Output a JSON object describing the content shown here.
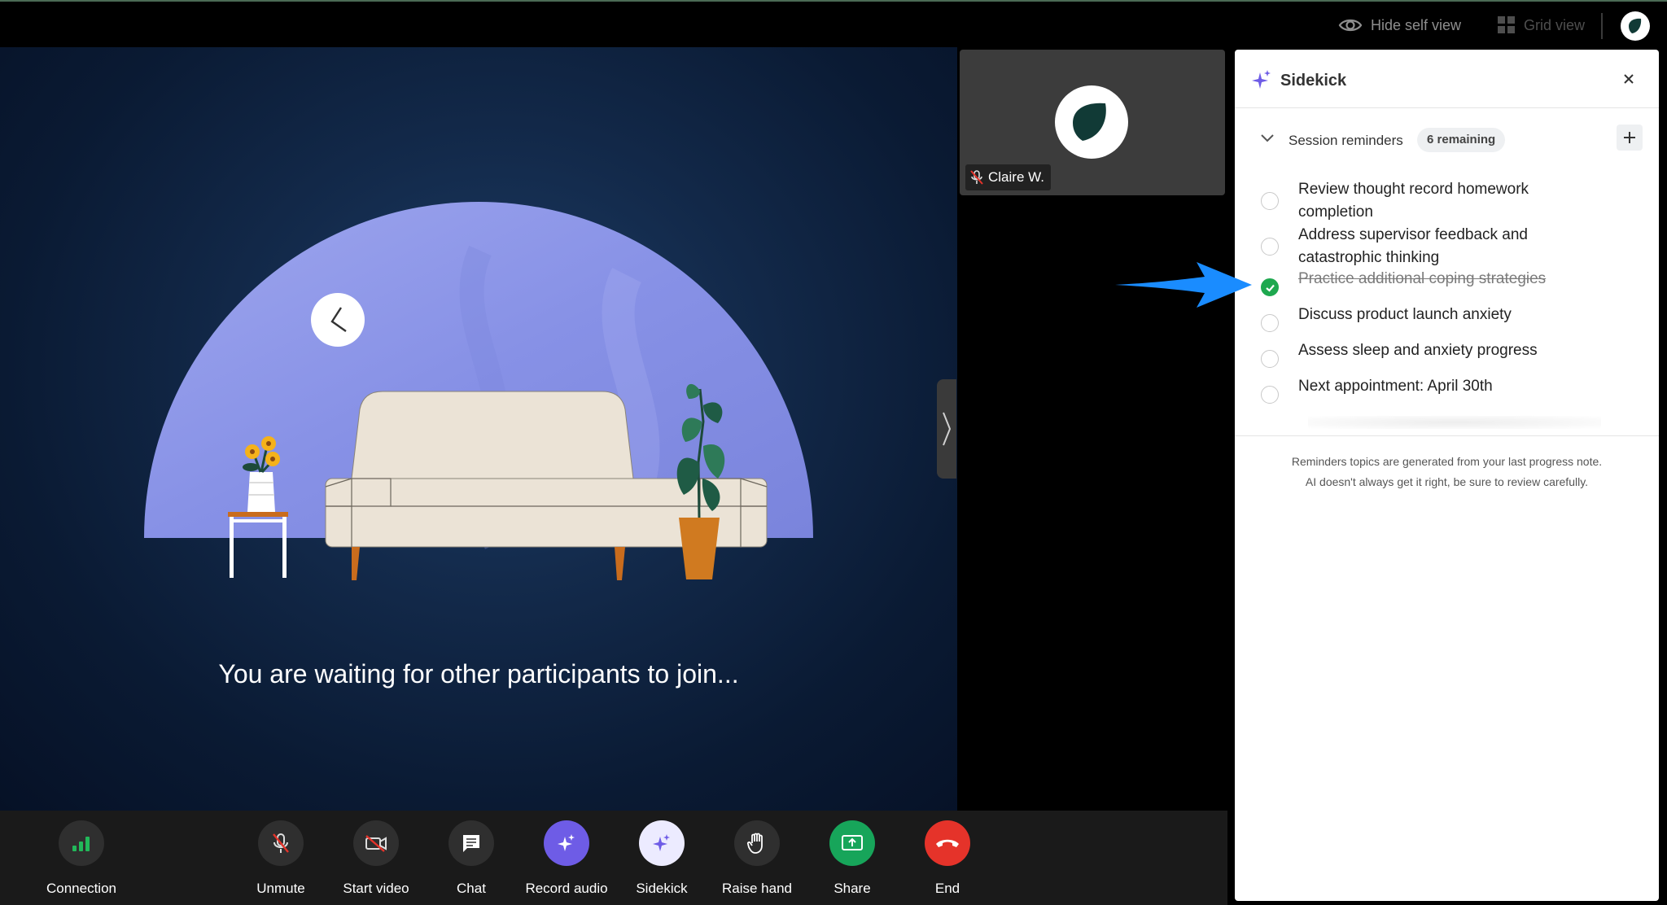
{
  "topbar": {
    "hide_self_view": "Hide self view",
    "grid_view": "Grid view",
    "icons": [
      "eye-icon",
      "grid-icon",
      "brand-logo-icon"
    ]
  },
  "stage": {
    "waiting_text": "You are waiting for other participants to join..."
  },
  "self_view": {
    "name": "Claire W.",
    "muted_icon": "mic-off-icon"
  },
  "sidekick": {
    "title": "Sidekick",
    "section_label": "Session reminders",
    "remaining": "6 remaining",
    "reminders": [
      {
        "text": "Review thought record homework completion",
        "done": false
      },
      {
        "text": "Address supervisor feedback and catastrophic thinking",
        "done": false
      },
      {
        "text": "Practice additional coping strategies",
        "done": true
      },
      {
        "text": "Discuss product launch anxiety",
        "done": false
      },
      {
        "text": "Assess sleep and anxiety progress",
        "done": false
      },
      {
        "text": "Next appointment: April 30th",
        "done": false
      }
    ],
    "disclaimer_line1": "Reminders topics are generated from your last progress note.",
    "disclaimer_line2": "AI doesn't always get it right, be sure to review carefully."
  },
  "toolbar": {
    "connection": "Connection",
    "unmute": "Unmute",
    "start_video": "Start video",
    "chat": "Chat",
    "record_audio": "Record audio",
    "sidekick": "Sidekick",
    "raise_hand": "Raise hand",
    "share": "Share",
    "end": "End"
  },
  "colors": {
    "accent_purple": "#6e5ce6",
    "share_green": "#17a55a",
    "end_red": "#e5332a",
    "done_green": "#1ea84f",
    "annotation_blue": "#1a8cff"
  }
}
